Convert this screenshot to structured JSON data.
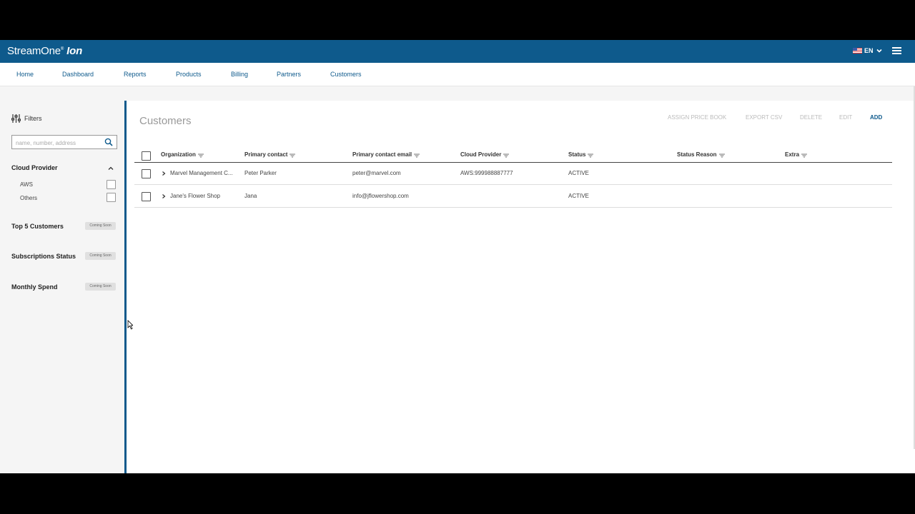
{
  "header": {
    "brand_main": "StreamOne",
    "brand_reg": "®",
    "brand_sub": "Ion",
    "language": "EN",
    "icons": [
      "us-flag-icon",
      "chevron-down-icon",
      "hamburger-menu-icon"
    ],
    "accent_color": "#0e5a8c"
  },
  "nav": {
    "items": [
      "Home",
      "Dashboard",
      "Reports",
      "Products",
      "Billing",
      "Partners",
      "Customers"
    ]
  },
  "sidebar": {
    "filters_label": "Filters",
    "search_placeholder": "name, number, address",
    "cloud_provider": {
      "title": "Cloud Provider",
      "options": [
        "AWS",
        "Others"
      ]
    },
    "sections": [
      {
        "title": "Top 5 Customers",
        "badge": "Coming Soon"
      },
      {
        "title": "Subscriptions Status",
        "badge": "Coming Soon"
      },
      {
        "title": "Monthly Spend",
        "badge": "Coming Soon"
      }
    ]
  },
  "main": {
    "title": "Customers",
    "actions": [
      "ASSIGN PRICE BOOK",
      "EXPORT CSV",
      "DELETE",
      "EDIT",
      "ADD"
    ],
    "columns": [
      "Organization",
      "Primary contact",
      "Primary contact email",
      "Cloud Provider",
      "Status",
      "Status Reason",
      "Extra"
    ],
    "rows": [
      {
        "organization": "Marvel Management C...",
        "contact": "Peter Parker",
        "email": "peter@marvel.com",
        "cloud": "AWS:999988887777",
        "status": "ACTIVE",
        "reason": "",
        "extra": ""
      },
      {
        "organization": "Jane's Flower Shop",
        "contact": "Jana",
        "email": "info@jflowershop.com",
        "cloud": "",
        "status": "ACTIVE",
        "reason": "",
        "extra": ""
      }
    ]
  }
}
